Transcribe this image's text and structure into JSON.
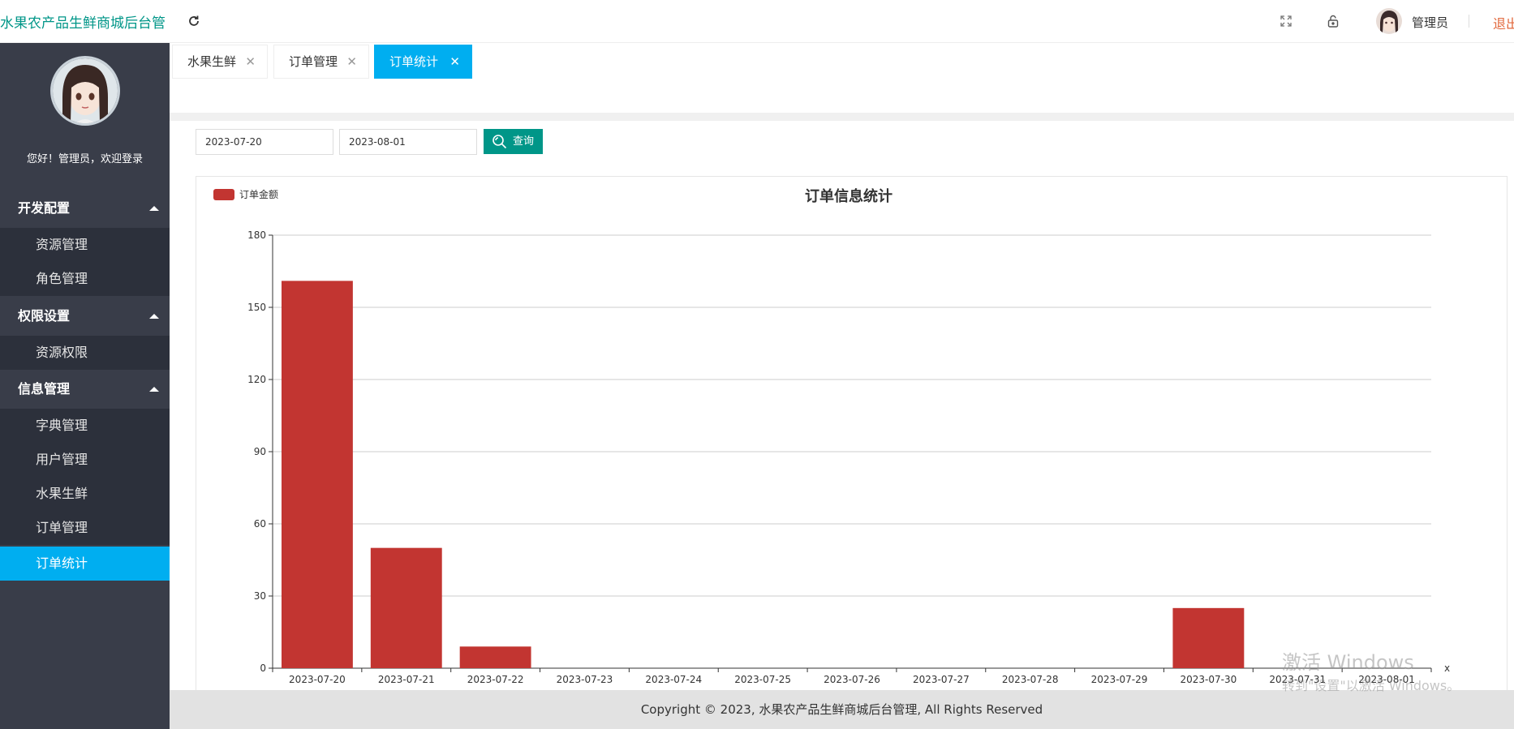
{
  "header": {
    "title": "水果农产品生鲜商城后台管",
    "admin_name": "管理员",
    "logout": "退出",
    "icons": [
      "refresh-icon",
      "fullscreen-icon",
      "lock-icon"
    ]
  },
  "sidebar": {
    "welcome": "您好！管理员，欢迎登录",
    "groups": [
      {
        "label": "开发配置",
        "items": [
          "资源管理",
          "角色管理"
        ]
      },
      {
        "label": "权限设置",
        "items": [
          "资源权限"
        ]
      },
      {
        "label": "信息管理",
        "items": [
          "字典管理",
          "用户管理",
          "水果生鲜",
          "订单管理",
          "订单统计"
        ]
      }
    ],
    "active_item": "订单统计"
  },
  "tabs": [
    {
      "label": "水果生鲜",
      "active": false
    },
    {
      "label": "订单管理",
      "active": false
    },
    {
      "label": "订单统计",
      "active": true
    }
  ],
  "filters": {
    "start_date": "2023-07-20",
    "end_date": "2023-08-01",
    "query_label": "查询"
  },
  "chart_data": {
    "type": "bar",
    "title": "订单信息统计",
    "legend": [
      "订单金额"
    ],
    "legend_position": "top-left",
    "xlabel": "x",
    "ylabel": "",
    "ylim": [
      0,
      180
    ],
    "yticks": [
      0,
      30,
      60,
      90,
      120,
      150,
      180
    ],
    "grid": true,
    "categories": [
      "2023-07-20",
      "2023-07-21",
      "2023-07-22",
      "2023-07-23",
      "2023-07-24",
      "2023-07-25",
      "2023-07-26",
      "2023-07-27",
      "2023-07-28",
      "2023-07-29",
      "2023-07-30",
      "2023-07-31",
      "2023-08-01"
    ],
    "series": [
      {
        "name": "订单金额",
        "values": [
          161,
          50,
          9,
          0,
          0,
          0,
          0,
          0,
          0,
          0,
          25,
          0,
          0
        ]
      }
    ],
    "bar_color": "#c23531"
  },
  "footer": {
    "text": "Copyright © 2023, 水果农产品生鲜商城后台管理, All Rights Reserved"
  },
  "watermark": {
    "line1": "激活 Windows",
    "line2": "转到\"设置\"以激活 Windows。"
  },
  "colors": {
    "accent": "#00aef0",
    "primary_btn": "#009688",
    "sidebar_bg": "#393d49",
    "logout": "#e2683c"
  }
}
